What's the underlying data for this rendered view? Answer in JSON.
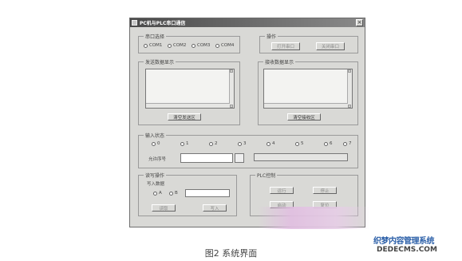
{
  "window": {
    "title": "PC机与PLC串口通信"
  },
  "serial": {
    "label": "串口选择",
    "ports": [
      "COM1",
      "COM2",
      "COM3",
      "COM4"
    ]
  },
  "operation": {
    "label": "操作",
    "open_label": "打开串口",
    "close_label": "关闭串口"
  },
  "send_area": {
    "label": "发送数据显示",
    "clear_label": "清空发送区"
  },
  "recv_area": {
    "label": "接收数据显示",
    "clear_label": "清空接收区"
  },
  "input_status": {
    "label": "输入状态",
    "radios": [
      "0",
      "1",
      "2",
      "3",
      "4",
      "5",
      "6",
      "7"
    ],
    "seq_label": "允许序号"
  },
  "read_write": {
    "label": "读写操作",
    "write_data_label": "写入数据",
    "radio_a": "A",
    "radio_b": "B",
    "btn_read": "读取",
    "btn_write": "写入"
  },
  "plc_control": {
    "label": "PLC控制",
    "btn_1": "运行",
    "btn_2": "停止",
    "btn_3": "启动",
    "btn_4": "复位"
  },
  "caption": "图2 系统界面",
  "watermark": {
    "text": "织梦内容管理系统",
    "url": "DEDECMS.COM"
  }
}
